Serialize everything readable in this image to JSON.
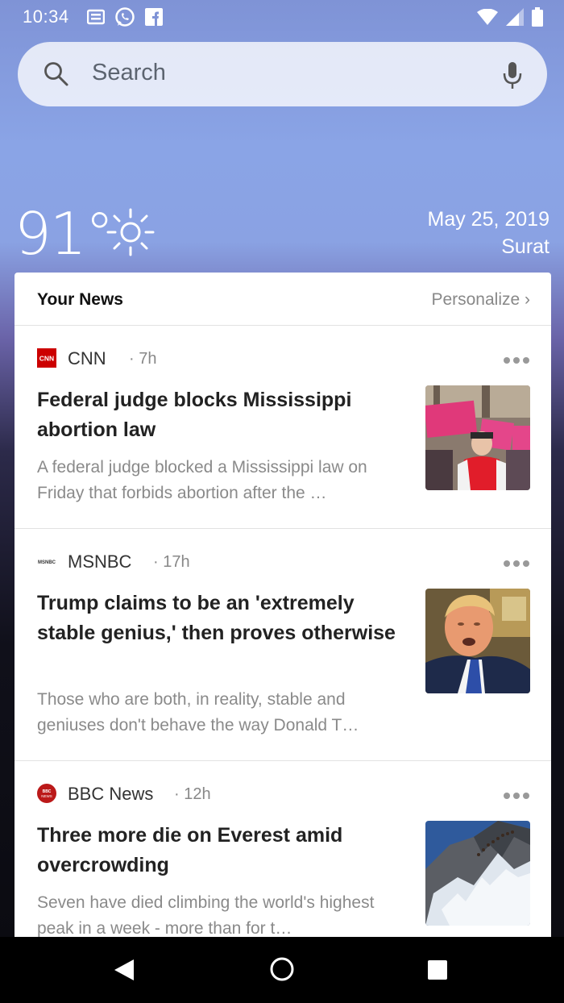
{
  "status_bar": {
    "time": "10:34",
    "left_icons": [
      "notification-message-icon",
      "whatsapp-icon",
      "facebook-icon"
    ],
    "right_icons": [
      "wifi-icon",
      "cell-signal-icon",
      "battery-icon"
    ]
  },
  "search": {
    "placeholder": "Search"
  },
  "weather": {
    "temperature": "91°",
    "condition_icon": "sun-icon",
    "date": "May 25, 2019",
    "city": "Surat"
  },
  "news": {
    "header_title": "Your News",
    "personalize_label": "Personalize ›",
    "articles": [
      {
        "source": "CNN",
        "time": "· 7h",
        "logo_color": "#cc0000",
        "headline": "Federal judge blocks Mississippi abortion law",
        "snippet": "A federal judge blocked a Mississippi law on Friday that forbids abortion after the …",
        "thumbnail": "protest-photo"
      },
      {
        "source": "MSNBC",
        "time": "· 17h",
        "logo_color": "#333333",
        "headline": "Trump claims to be an 'extremely stable genius,' then proves otherwise",
        "snippet": "Those who are both, in reality, stable and geniuses don't behave the way Donald T…",
        "thumbnail": "portrait-photo"
      },
      {
        "source": "BBC News",
        "time": "· 12h",
        "logo_color": "#bb1919",
        "headline": "Three more die on Everest amid overcrowding",
        "snippet": "Seven have died climbing the world's highest peak in a week - more than for t…",
        "thumbnail": "mountain-photo"
      }
    ]
  },
  "nav": {
    "buttons": [
      "back",
      "home",
      "recents"
    ]
  }
}
